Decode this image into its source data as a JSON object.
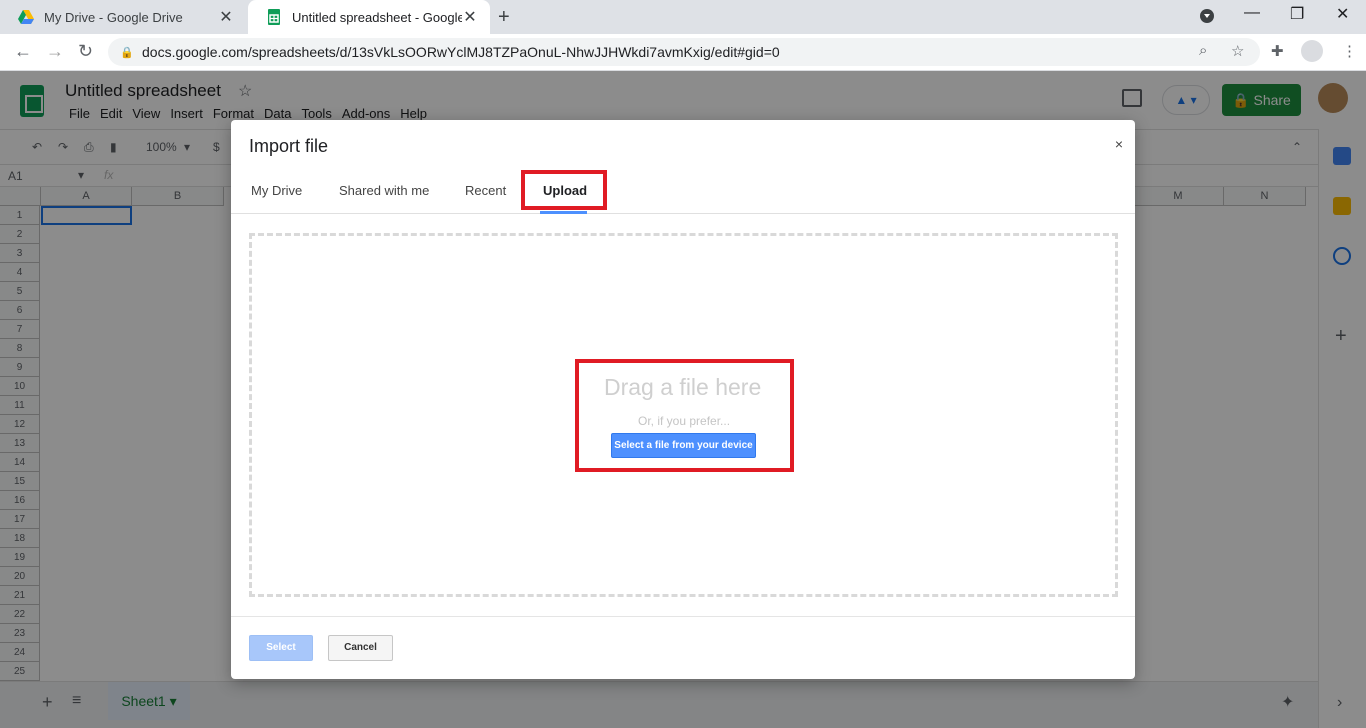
{
  "browser": {
    "tabs": [
      {
        "title": "My Drive - Google Drive",
        "active": false
      },
      {
        "title": "Untitled spreadsheet - Google Sh",
        "active": true
      }
    ],
    "url": "docs.google.com/spreadsheets/d/13sVkLsOORwYclMJ8TZPaOnuL-NhwJJHWkdi7avmKxig/edit#gid=0"
  },
  "sheets": {
    "doc_title": "Untitled spreadsheet",
    "menu": [
      "File",
      "Edit",
      "View",
      "Insert",
      "Format",
      "Data",
      "Tools",
      "Add-ons",
      "Help"
    ],
    "share_label": "Share",
    "zoom": "100%",
    "currency": "$",
    "name_box": "A1",
    "fx": "fx",
    "columns": [
      "A",
      "B",
      "M",
      "N"
    ],
    "rows": [
      "1",
      "2",
      "3",
      "4",
      "5",
      "6",
      "7",
      "8",
      "9",
      "10",
      "11",
      "12",
      "13",
      "14",
      "15",
      "16",
      "17",
      "18",
      "19",
      "20",
      "21",
      "22",
      "23",
      "24",
      "25"
    ],
    "sheet_tab": "Sheet1"
  },
  "dialog": {
    "title": "Import file",
    "close": "×",
    "tabs": [
      "My Drive",
      "Shared with me",
      "Recent",
      "Upload"
    ],
    "drag_text": "Drag a file here",
    "prefer_text": "Or, if you prefer...",
    "device_button": "Select a file from your device",
    "select_button": "Select",
    "cancel_button": "Cancel"
  },
  "colors": {
    "share_green": "#1e8e3e",
    "accent_blue": "#4d90fe",
    "highlight_red": "#e01b24"
  }
}
